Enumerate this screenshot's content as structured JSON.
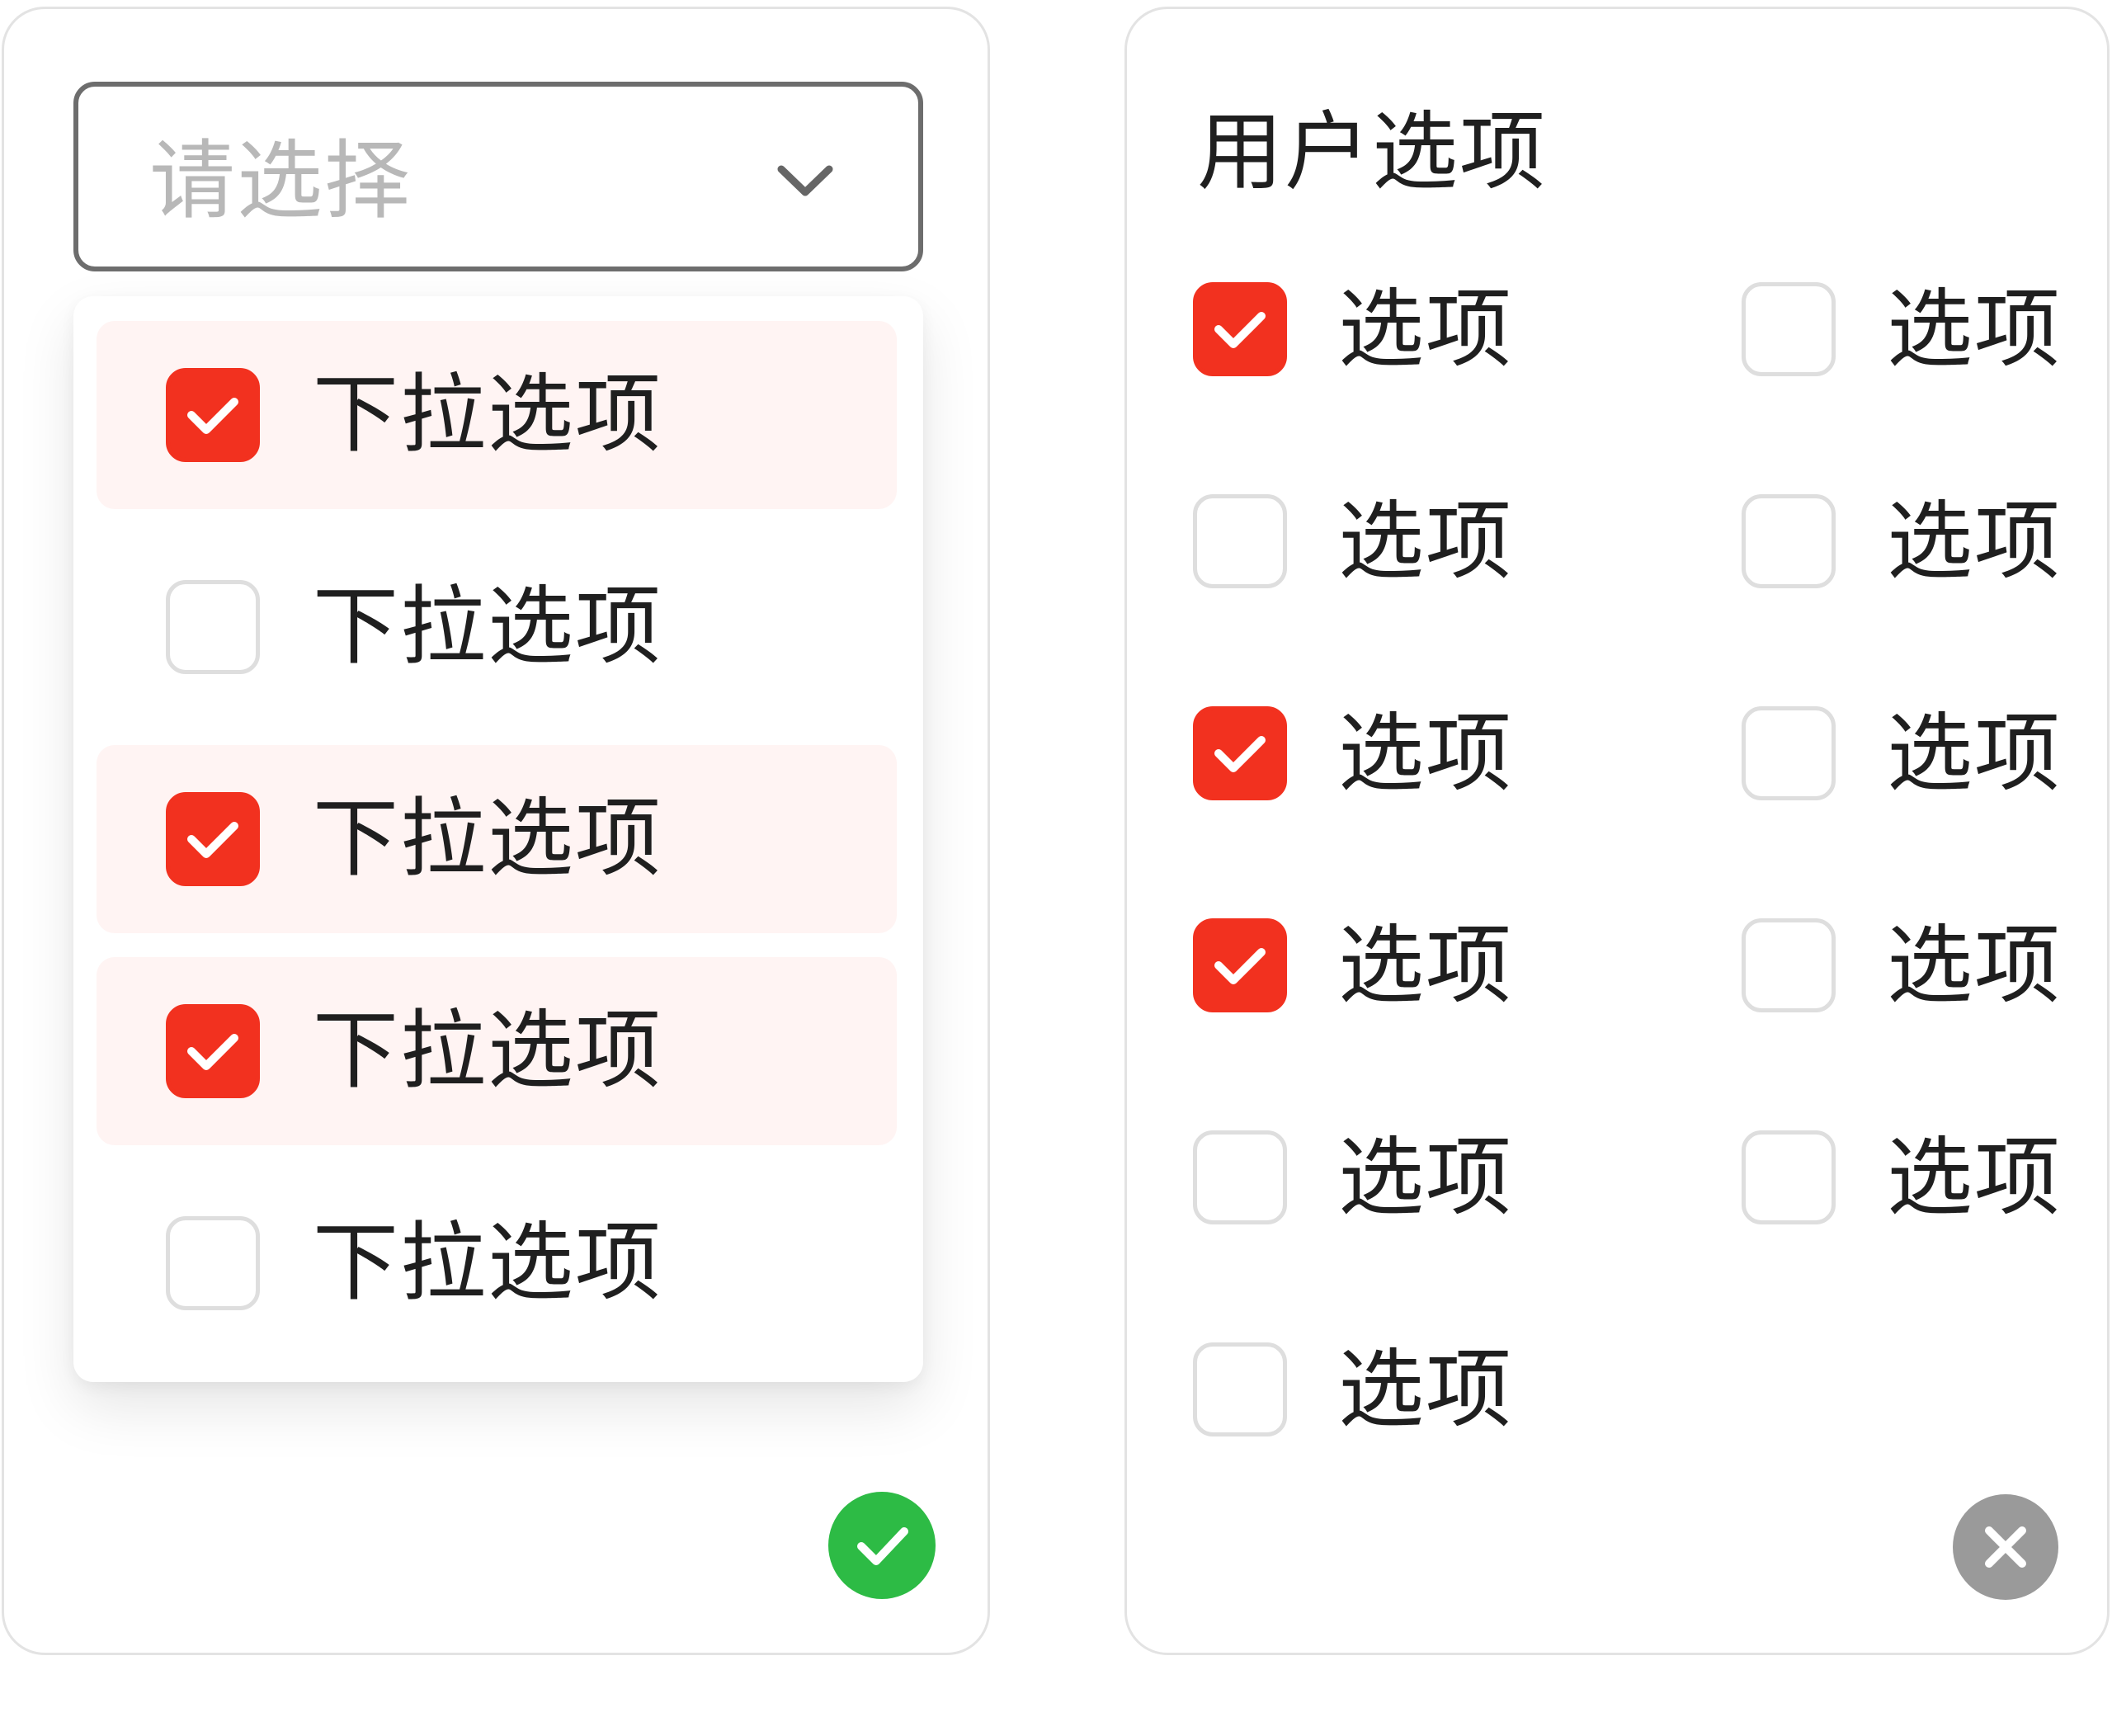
{
  "dropdown_select": {
    "placeholder": "请选择",
    "arrow_icon": "chevron-down-icon",
    "items": [
      {
        "label": "下拉选项",
        "checked": true
      },
      {
        "label": "下拉选项",
        "checked": false
      },
      {
        "label": "下拉选项",
        "checked": true
      },
      {
        "label": "下拉选项",
        "checked": true
      },
      {
        "label": "下拉选项",
        "checked": false
      }
    ],
    "confirm_icon": "check-icon"
  },
  "user_options": {
    "title": "用户选项",
    "options": [
      {
        "label": "选项",
        "checked": true
      },
      {
        "label": "选项",
        "checked": false
      },
      {
        "label": "选项",
        "checked": false
      },
      {
        "label": "选项",
        "checked": false
      },
      {
        "label": "选项",
        "checked": true
      },
      {
        "label": "选项",
        "checked": false
      },
      {
        "label": "选项",
        "checked": true
      },
      {
        "label": "选项",
        "checked": false
      },
      {
        "label": "选项",
        "checked": false
      },
      {
        "label": "选项",
        "checked": false
      },
      {
        "label": "选项",
        "checked": false
      }
    ],
    "close_icon": "close-icon"
  },
  "colors": {
    "checked": "#f2311f",
    "selected_row": "#fff4f3",
    "confirm": "#2dbb45",
    "close": "#9a9a9a",
    "unchecked_border": "#dedede"
  }
}
